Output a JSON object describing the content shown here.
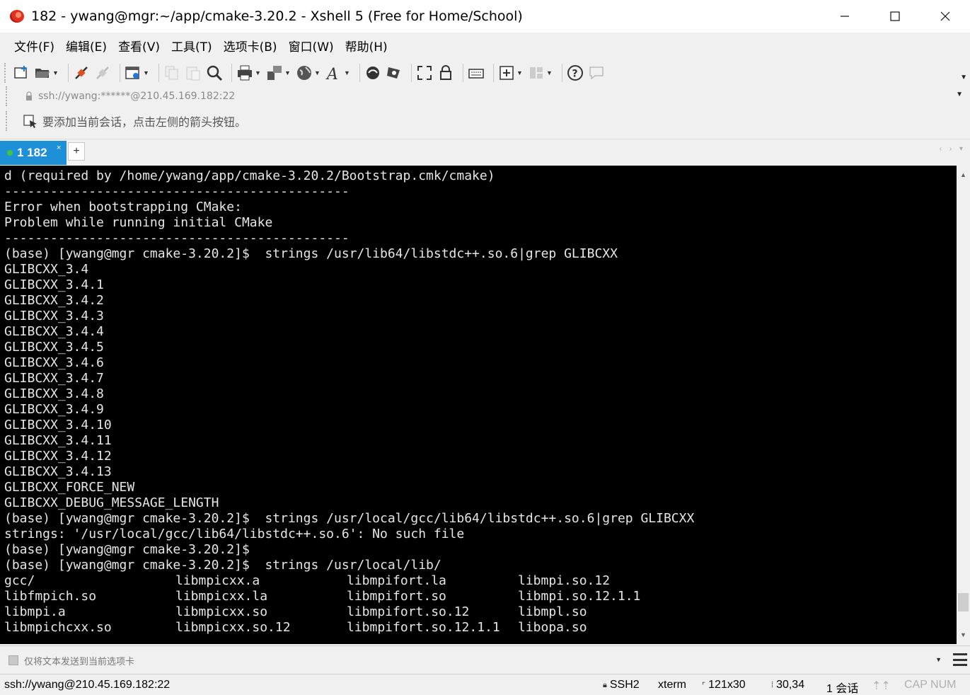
{
  "window": {
    "title": "182 - ywang@mgr:~/app/cmake-3.20.2 - Xshell 5 (Free for Home/School)"
  },
  "menu": [
    "文件(F)",
    "编辑(E)",
    "查看(V)",
    "工具(T)",
    "选项卡(B)",
    "窗口(W)",
    "帮助(H)"
  ],
  "toolbar": {
    "icons": [
      "new-session-icon",
      "open-folder-icon",
      "reconnect-icon",
      "disconnect-icon",
      "properties-icon",
      "copy-icon",
      "paste-icon",
      "find-icon",
      "print-icon",
      "transfer-icon",
      "globe-icon",
      "font-icon",
      "xftp-icon",
      "xmanager-icon",
      "fullscreen-icon",
      "lock-icon",
      "keyboard-icon",
      "compose-icon",
      "layout-icon",
      "help-icon",
      "chat-icon"
    ]
  },
  "address": {
    "text": "ssh://ywang:******@210.45.169.182:22"
  },
  "hint": {
    "text": "要添加当前会话，点击左侧的箭头按钮。"
  },
  "tabs": [
    {
      "label": "1 182",
      "active": true
    }
  ],
  "terminal": {
    "lines": [
      "d (required by /home/ywang/app/cmake-3.20.2/Bootstrap.cmk/cmake)",
      "---------------------------------------------",
      "Error when bootstrapping CMake:",
      "Problem while running initial CMake",
      "---------------------------------------------",
      "(base) [ywang@mgr cmake-3.20.2]$  strings /usr/lib64/libstdc++.so.6|grep GLIBCXX",
      "GLIBCXX_3.4",
      "GLIBCXX_3.4.1",
      "GLIBCXX_3.4.2",
      "GLIBCXX_3.4.3",
      "GLIBCXX_3.4.4",
      "GLIBCXX_3.4.5",
      "GLIBCXX_3.4.6",
      "GLIBCXX_3.4.7",
      "GLIBCXX_3.4.8",
      "GLIBCXX_3.4.9",
      "GLIBCXX_3.4.10",
      "GLIBCXX_3.4.11",
      "GLIBCXX_3.4.12",
      "GLIBCXX_3.4.13",
      "GLIBCXX_FORCE_NEW",
      "GLIBCXX_DEBUG_MESSAGE_LENGTH",
      "(base) [ywang@mgr cmake-3.20.2]$  strings /usr/local/gcc/lib64/libstdc++.so.6|grep GLIBCXX",
      "strings: '/usr/local/gcc/lib64/libstdc++.so.6': No such file",
      "(base) [ywang@mgr cmake-3.20.2]$",
      "(base) [ywang@mgr cmake-3.20.2]$  strings /usr/local/lib/"
    ],
    "ls_rows": [
      [
        "gcc/",
        "libmpicxx.a",
        "libmpifort.la",
        "libmpi.so.12"
      ],
      [
        "libfmpich.so",
        "libmpicxx.la",
        "libmpifort.so",
        "libmpi.so.12.1.1"
      ],
      [
        "libmpi.a",
        "libmpicxx.so",
        "libmpifort.so.12",
        "libmpl.so"
      ],
      [
        "libmpichcxx.so",
        "libmpicxx.so.12",
        "libmpifort.so.12.1.1",
        "libopa.so"
      ]
    ]
  },
  "sendbar": {
    "text": "仅将文本发送到当前选项卡"
  },
  "status": {
    "connection": "ssh://ywang@210.45.169.182:22",
    "protocol": "SSH2",
    "terminal_type": "xterm",
    "size": "121x30",
    "cursor": "30,34",
    "sessions": "1 会话",
    "keys": "CAP NUM"
  }
}
